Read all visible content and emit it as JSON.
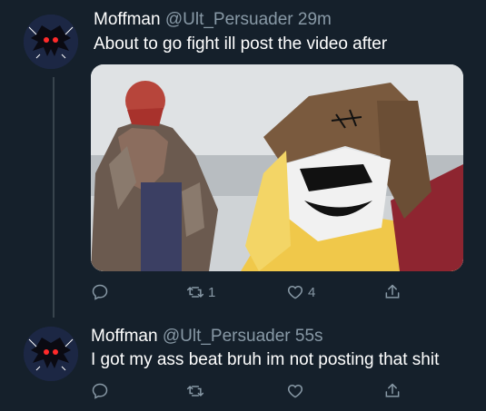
{
  "tweets": [
    {
      "name": "Moffman",
      "handle": "@Ult_Persuader",
      "time": "29m",
      "text": "About to go fight ill post the video after",
      "reply_count": "",
      "retweet_count": "1",
      "like_count": "4"
    },
    {
      "name": "Moffman",
      "handle": "@Ult_Persuader",
      "time": "55s",
      "text": "I got my ass beat bruh im not posting that shit",
      "reply_count": "",
      "retweet_count": "",
      "like_count": ""
    }
  ],
  "icons": {
    "reply": "reply-icon",
    "retweet": "retweet-icon",
    "like": "heart-icon",
    "share": "share-icon"
  },
  "colors": {
    "background": "#15202b",
    "secondary_text": "#8899a6",
    "thread_line": "#38444d"
  }
}
